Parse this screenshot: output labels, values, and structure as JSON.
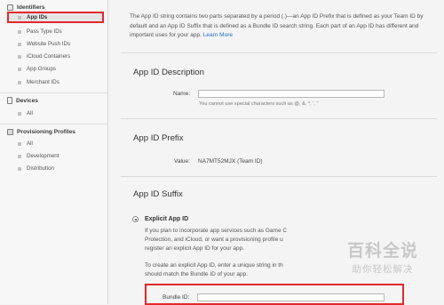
{
  "sidebar": {
    "identifiers": {
      "heading": "Identifiers",
      "items": [
        "App IDs",
        "Pass Type IDs",
        "Website Push IDs",
        "iCloud Containers",
        "App Groups",
        "Merchant IDs"
      ]
    },
    "devices": {
      "heading": "Devices",
      "items": [
        "All"
      ]
    },
    "profiles": {
      "heading": "Provisioning Profiles",
      "items": [
        "All",
        "Development",
        "Distribution"
      ]
    }
  },
  "intro": {
    "text": "The App ID string contains two parts separated by a period (.)—an App ID Prefix that is defined as your Team ID by default and an App ID Suffix that is defined as a Bundle ID search string. Each part of an App ID has different and important uses for your app.",
    "link": "Learn More"
  },
  "description": {
    "title": "App ID Description",
    "name_label": "Name:",
    "name_value": "",
    "hint": "You cannot use special characters such as @, &, *, ', \""
  },
  "prefix": {
    "title": "App ID Prefix",
    "value_label": "Value:",
    "value": "NA7MT52MJX (Team ID)"
  },
  "suffix": {
    "title": "App ID Suffix",
    "option_title": "Explicit App ID",
    "para1": [
      "If you plan to incorporate app services such as Game C",
      "Protection, and iCloud, or want a provisioning profile u",
      "register an explicit App ID for your app."
    ],
    "para2": [
      "To create an explicit App ID, enter a unique string in th",
      "should match the Bundle ID of your app."
    ],
    "bundle_label": "Bundle ID:",
    "bundle_value": ""
  },
  "watermark": {
    "big": "百科全说",
    "small": "助你轻松解决"
  },
  "colors": {
    "highlight": "#e2282c",
    "link": "#1a72c6"
  }
}
